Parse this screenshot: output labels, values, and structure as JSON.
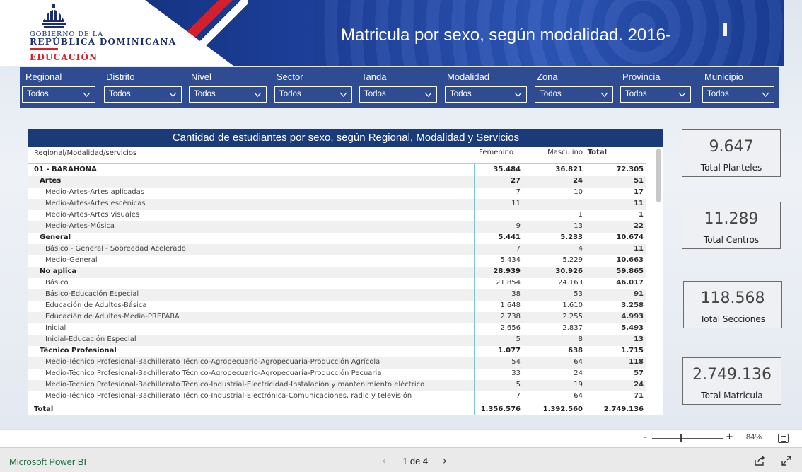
{
  "header": {
    "logo": {
      "line1": "GOBIERNO DE LA",
      "line2": "REPÚBLICA DOMINICANA",
      "line3": "EDUCACIÓN"
    },
    "title": "Matricula por sexo, según modalidad. 2016-"
  },
  "filters": [
    {
      "label": "Regional",
      "value": "Todos"
    },
    {
      "label": "Distrito",
      "value": "Todos"
    },
    {
      "label": "Nivel",
      "value": "Todos"
    },
    {
      "label": "Sector",
      "value": "Todos"
    },
    {
      "label": "Tanda",
      "value": "Todos"
    },
    {
      "label": "Modalidad",
      "value": "Todos"
    },
    {
      "label": "Zona",
      "value": "Todos"
    },
    {
      "label": "Provincia",
      "value": "Todos"
    },
    {
      "label": "Municipio",
      "value": "Todos"
    }
  ],
  "table": {
    "title": "Cantidad de estudiantes por sexo, según Regional, Modalidad y Servicios",
    "columns": {
      "label": "Regional/Modalidad/servicios",
      "female": "Femenino",
      "male": "Masculino",
      "total": "Total"
    },
    "rows": [
      {
        "label": "01 - BARAHONA",
        "level": 0,
        "female": "35.484",
        "male": "36.821",
        "total": "72.305"
      },
      {
        "label": "Artes",
        "level": 1,
        "female": "27",
        "male": "24",
        "total": "51"
      },
      {
        "label": "Medio-Artes-Artes aplicadas",
        "level": 2,
        "female": "7",
        "male": "10",
        "total": "17"
      },
      {
        "label": "Medio-Artes-Artes escénicas",
        "level": 2,
        "female": "11",
        "male": "",
        "total": "11"
      },
      {
        "label": "Medio-Artes-Artes visuales",
        "level": 2,
        "female": "",
        "male": "1",
        "total": "1"
      },
      {
        "label": "Medio-Artes-Música",
        "level": 2,
        "female": "9",
        "male": "13",
        "total": "22"
      },
      {
        "label": "General",
        "level": 1,
        "female": "5.441",
        "male": "5.233",
        "total": "10.674"
      },
      {
        "label": "Básico - General - Sobreedad Acelerado",
        "level": 2,
        "female": "7",
        "male": "4",
        "total": "11"
      },
      {
        "label": "Medio-General",
        "level": 2,
        "female": "5.434",
        "male": "5.229",
        "total": "10.663"
      },
      {
        "label": "No aplica",
        "level": 1,
        "female": "28.939",
        "male": "30.926",
        "total": "59.865"
      },
      {
        "label": "Básico",
        "level": 2,
        "female": "21.854",
        "male": "24.163",
        "total": "46.017"
      },
      {
        "label": "Básico-Educación Especial",
        "level": 2,
        "female": "38",
        "male": "53",
        "total": "91"
      },
      {
        "label": "Educación de Adultos-Básica",
        "level": 2,
        "female": "1.648",
        "male": "1.610",
        "total": "3.258"
      },
      {
        "label": "Educación de Adultos-Media-PREPARA",
        "level": 2,
        "female": "2.738",
        "male": "2.255",
        "total": "4.993"
      },
      {
        "label": "Inicial",
        "level": 2,
        "female": "2.656",
        "male": "2.837",
        "total": "5.493"
      },
      {
        "label": "Inicial-Educación Especial",
        "level": 2,
        "female": "5",
        "male": "8",
        "total": "13"
      },
      {
        "label": "Técnico Profesional",
        "level": 1,
        "female": "1.077",
        "male": "638",
        "total": "1.715"
      },
      {
        "label": "Medio-Técnico Profesional-Bachillerato Técnico-Agropecuario-Agropecuaria-Producción Agrícola",
        "level": 2,
        "female": "54",
        "male": "64",
        "total": "118"
      },
      {
        "label": "Medio-Técnico Profesional-Bachillerato Técnico-Agropecuario-Agropecuaria-Producción Pecuaria",
        "level": 2,
        "female": "33",
        "male": "24",
        "total": "57"
      },
      {
        "label": "Medio-Técnico Profesional-Bachillerato Técnico-Industrial-Electricidad-Instalación y mantenimiento eléctrico",
        "level": 2,
        "female": "5",
        "male": "19",
        "total": "24"
      },
      {
        "label": "Medio-Técnico Profesional-Bachillerato Técnico-Industrial-Electrónica-Comunicaciones, radio y televisión",
        "level": 2,
        "female": "7",
        "male": "64",
        "total": "71"
      }
    ],
    "total_row": {
      "label": "Total",
      "female": "1.356.576",
      "male": "1.392.560",
      "total": "2.749.136"
    }
  },
  "kpis": [
    {
      "value": "9.647",
      "label": "Total Planteles"
    },
    {
      "value": "11.289",
      "label": "Total Centros"
    },
    {
      "value": "118.568",
      "label": "Total Secciones"
    },
    {
      "value": "2.749.136",
      "label": "Total Matricula"
    }
  ],
  "zoom": {
    "minus": "-",
    "plus": "+",
    "percent": "84%"
  },
  "footer": {
    "brand": "Microsoft Power BI",
    "page_indicator": "1 de 4"
  }
}
